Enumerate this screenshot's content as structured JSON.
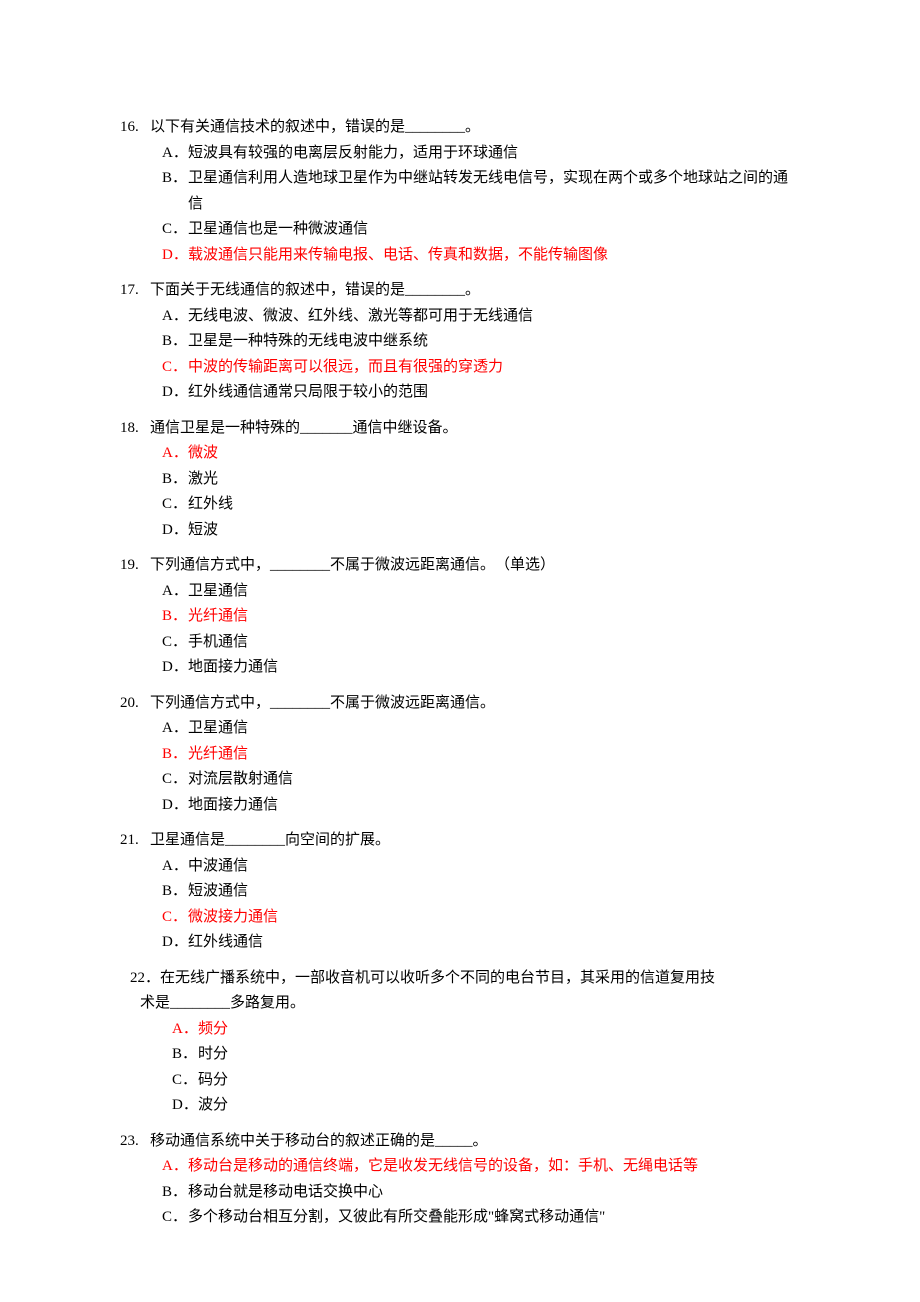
{
  "questions": [
    {
      "num": "16.",
      "stem": "以下有关通信技术的叙述中，错误的是________。",
      "options": [
        {
          "letter": "A．",
          "text": "短波具有较强的电离层反射能力，适用于环球通信",
          "red": false
        },
        {
          "letter": "B．",
          "text": "卫星通信利用人造地球卫星作为中继站转发无线电信号，实现在两个或多个地球站之间的通信",
          "red": false,
          "wrap": true
        },
        {
          "letter": "C．",
          "text": "卫星通信也是一种微波通信",
          "red": false
        },
        {
          "letter": "D．",
          "text": "载波通信只能用来传输电报、电话、传真和数据，不能传输图像",
          "red": true
        }
      ]
    },
    {
      "num": "17.",
      "stem": "下面关于无线通信的叙述中，错误的是________。",
      "options": [
        {
          "letter": "A．",
          "text": "无线电波、微波、红外线、激光等都可用于无线通信",
          "red": false
        },
        {
          "letter": "B．",
          "text": "卫星是一种特殊的无线电波中继系统",
          "red": false
        },
        {
          "letter": "C．",
          "text": "中波的传输距离可以很远，而且有很强的穿透力",
          "red": true
        },
        {
          "letter": "D．",
          "text": "红外线通信通常只局限于较小的范围",
          "red": false
        }
      ]
    },
    {
      "num": "18.",
      "stem": "通信卫星是一种特殊的_______通信中继设备。",
      "options": [
        {
          "letter": "A．",
          "text": "微波",
          "red": true
        },
        {
          "letter": "B．",
          "text": "激光",
          "red": false
        },
        {
          "letter": "C．",
          "text": "红外线",
          "red": false
        },
        {
          "letter": "D．",
          "text": "短波",
          "red": false
        }
      ]
    },
    {
      "num": "19.",
      "stem": "下列通信方式中，________不属于微波远距离通信。　（单选）",
      "options": [
        {
          "letter": "A．",
          "text": "卫星通信",
          "red": false
        },
        {
          "letter": "B．",
          "text": "光纤通信",
          "red": true
        },
        {
          "letter": "C．",
          "text": "手机通信",
          "red": false
        },
        {
          "letter": "D．",
          "text": "地面接力通信",
          "red": false
        }
      ]
    },
    {
      "num": "20.",
      "stem": "下列通信方式中，________不属于微波远距离通信。",
      "options": [
        {
          "letter": "A．",
          "text": "卫星通信",
          "red": false
        },
        {
          "letter": "B．",
          "text": "光纤通信",
          "red": true
        },
        {
          "letter": "C．",
          "text": "对流层散射通信",
          "red": false
        },
        {
          "letter": "D．",
          "text": "地面接力通信",
          "red": false
        }
      ]
    },
    {
      "num": "21.",
      "stem": "卫星通信是________向空间的扩展。",
      "options": [
        {
          "letter": "A．",
          "text": "中波通信",
          "red": false
        },
        {
          "letter": "B．",
          "text": "短波通信",
          "red": false
        },
        {
          "letter": "C．",
          "text": "微波接力通信",
          "red": true
        },
        {
          "letter": "D．",
          "text": "红外线通信",
          "red": false
        }
      ]
    },
    {
      "num": "22．",
      "stem_line1": "在无线广播系统中，一部收音机可以收听多个不同的电台节目，其采用的信道复用技",
      "stem_line2": "术是________多路复用。",
      "options": [
        {
          "letter": "A．",
          "text": "频分",
          "red": true
        },
        {
          "letter": "B．",
          "text": "时分",
          "red": false
        },
        {
          "letter": "C．",
          "text": "码分",
          "red": false
        },
        {
          "letter": "D．",
          "text": "波分",
          "red": false
        }
      ]
    },
    {
      "num": "23.",
      "stem": "移动通信系统中关于移动台的叙述正确的是_____。",
      "options": [
        {
          "letter": "A．",
          "text": "移动台是移动的通信终端，它是收发无线信号的设备，如：手机、无绳电话等",
          "red": true
        },
        {
          "letter": "B．",
          "text": "移动台就是移动电话交换中心",
          "red": false
        },
        {
          "letter": "C．",
          "text": "多个移动台相互分割，又彼此有所交叠能形成\"蜂窝式移动通信\"",
          "red": false
        }
      ]
    }
  ]
}
